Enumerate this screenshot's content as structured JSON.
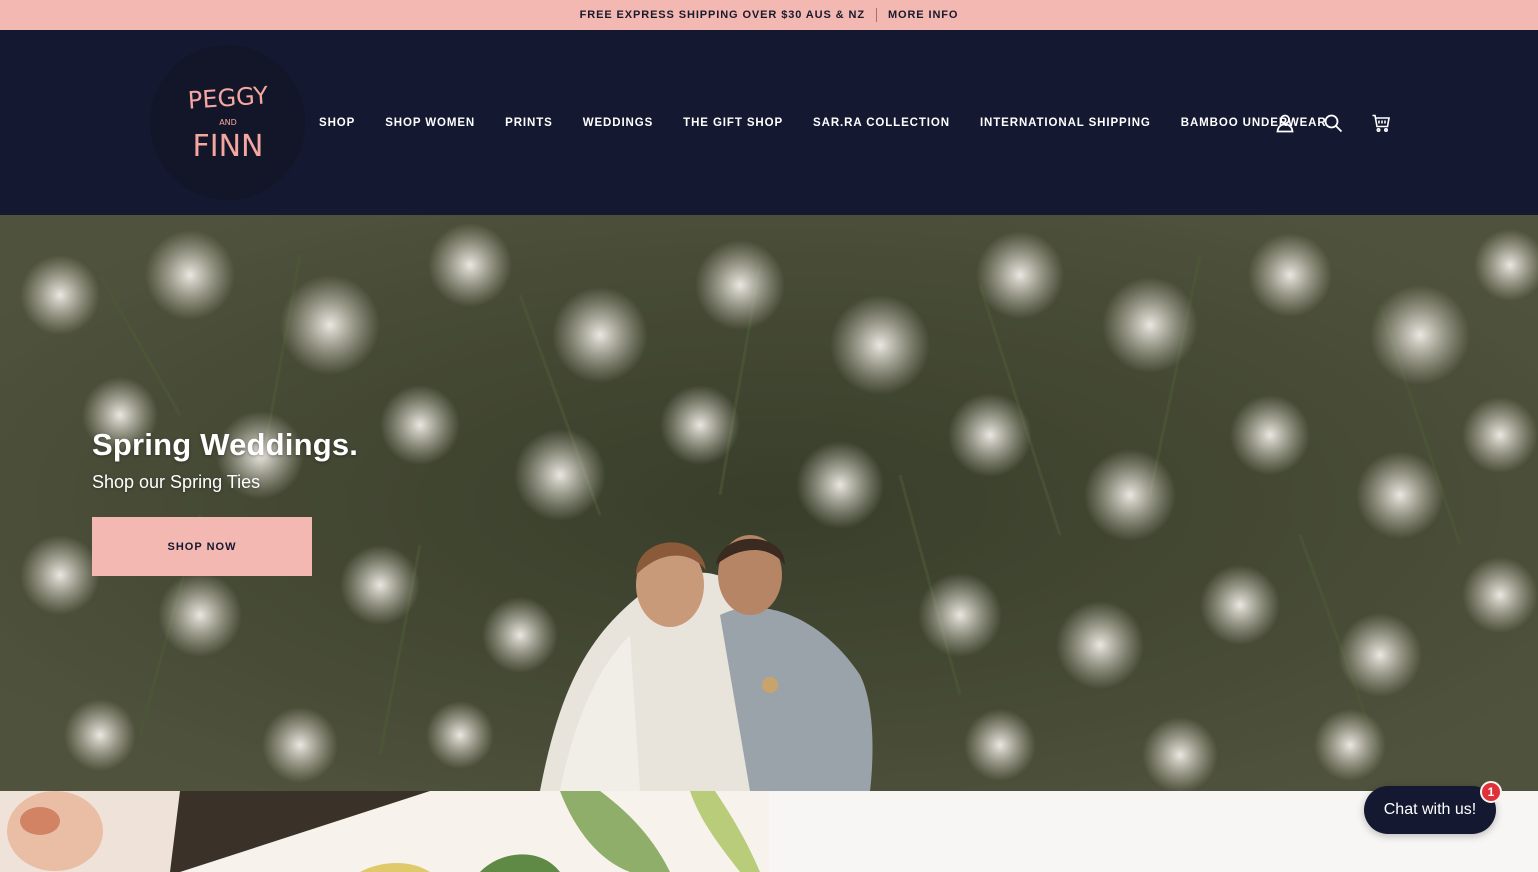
{
  "announcement": {
    "text": "FREE EXPRESS SHIPPING OVER $30 AUS & NZ",
    "link": "MORE INFO"
  },
  "header": {
    "logo_text": [
      "PEGGY",
      "AND",
      "FINN"
    ],
    "nav": [
      "SHOP",
      "SHOP WOMEN",
      "PRINTS",
      "WEDDINGS",
      "THE GIFT SHOP",
      "SAR.RA COLLECTION",
      "INTERNATIONAL SHIPPING",
      "BAMBOO UNDERWEAR"
    ],
    "icons": [
      "account-icon",
      "search-icon",
      "cart-icon"
    ]
  },
  "hero": {
    "title": "Spring Weddings.",
    "subtitle": "Shop our Spring Ties",
    "button": "SHOP NOW"
  },
  "chat": {
    "label": "Chat with us!",
    "badge": "1"
  },
  "colors": {
    "announcement_bg": "#f4b8b2",
    "header_bg": "#141830",
    "button_bg": "#f4b8b2",
    "logo_text": "#f4a6a0",
    "badge": "#e0303a"
  }
}
